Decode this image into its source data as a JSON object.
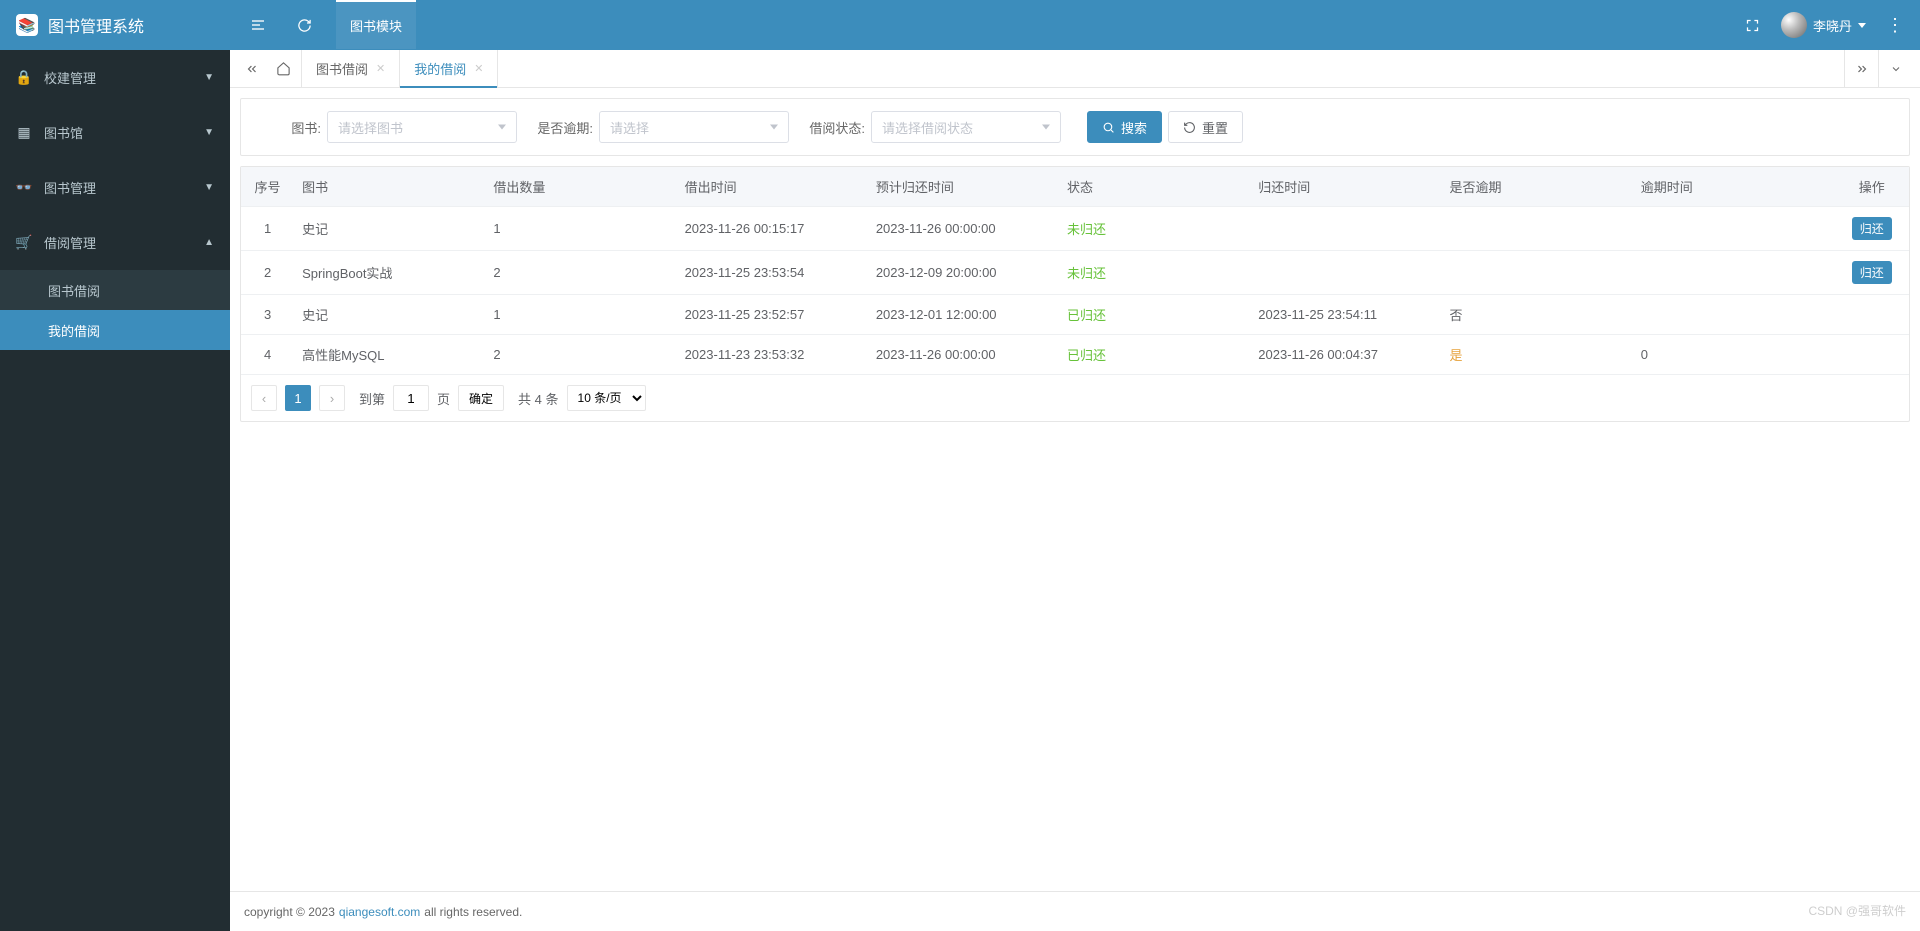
{
  "header": {
    "app_title": "图书管理系统",
    "module_label": "图书模块",
    "user_name": "李晓丹"
  },
  "sidebar": {
    "items": [
      {
        "label": "校建管理",
        "expanded": false
      },
      {
        "label": "图书馆",
        "expanded": false
      },
      {
        "label": "图书管理",
        "expanded": false
      },
      {
        "label": "借阅管理",
        "expanded": true,
        "children": [
          {
            "label": "图书借阅",
            "active": false
          },
          {
            "label": "我的借阅",
            "active": true
          }
        ]
      }
    ]
  },
  "tabs": {
    "items": [
      {
        "label": "图书借阅",
        "active": false
      },
      {
        "label": "我的借阅",
        "active": true
      }
    ]
  },
  "search": {
    "book_label": "图书:",
    "book_placeholder": "请选择图书",
    "overdue_label": "是否逾期:",
    "overdue_placeholder": "请选择",
    "status_label": "借阅状态:",
    "status_placeholder": "请选择借阅状态",
    "search_btn": "搜索",
    "reset_btn": "重置"
  },
  "table": {
    "headers": {
      "idx": "序号",
      "book": "图书",
      "qty": "借出数量",
      "lend_time": "借出时间",
      "expect_time": "预计归还时间",
      "status": "状态",
      "return_time": "归还时间",
      "is_overdue": "是否逾期",
      "overdue_days": "逾期时间",
      "ops": "操作"
    },
    "rows": [
      {
        "idx": "1",
        "book": "史记",
        "qty": "1",
        "lend_time": "2023-11-26 00:15:17",
        "expect_time": "2023-11-26 00:00:00",
        "status": "未归还",
        "status_cls": "st-green",
        "return_time": "",
        "is_overdue": "",
        "overdue_cls": "",
        "overdue_days": "",
        "op": "归还"
      },
      {
        "idx": "2",
        "book": "SpringBoot实战",
        "qty": "2",
        "lend_time": "2023-11-25 23:53:54",
        "expect_time": "2023-12-09 20:00:00",
        "status": "未归还",
        "status_cls": "st-green",
        "return_time": "",
        "is_overdue": "",
        "overdue_cls": "",
        "overdue_days": "",
        "op": "归还"
      },
      {
        "idx": "3",
        "book": "史记",
        "qty": "1",
        "lend_time": "2023-11-25 23:52:57",
        "expect_time": "2023-12-01 12:00:00",
        "status": "已归还",
        "status_cls": "st-green",
        "return_time": "2023-11-25 23:54:11",
        "is_overdue": "否",
        "overdue_cls": "",
        "overdue_days": "",
        "op": ""
      },
      {
        "idx": "4",
        "book": "高性能MySQL",
        "qty": "2",
        "lend_time": "2023-11-23 23:53:32",
        "expect_time": "2023-11-26 00:00:00",
        "status": "已归还",
        "status_cls": "st-green",
        "return_time": "2023-11-26 00:04:37",
        "is_overdue": "是",
        "overdue_cls": "st-orange",
        "overdue_days": "0",
        "op": ""
      }
    ]
  },
  "pager": {
    "current": "1",
    "goto_label": "到第",
    "goto_value": "1",
    "page_unit": "页",
    "confirm": "确定",
    "total": "共 4 条",
    "size": "10 条/页"
  },
  "footer": {
    "prefix": "copyright © 2023",
    "link": "qiangesoft.com",
    "suffix": "all rights reserved."
  },
  "watermark": "CSDN @强哥软件"
}
